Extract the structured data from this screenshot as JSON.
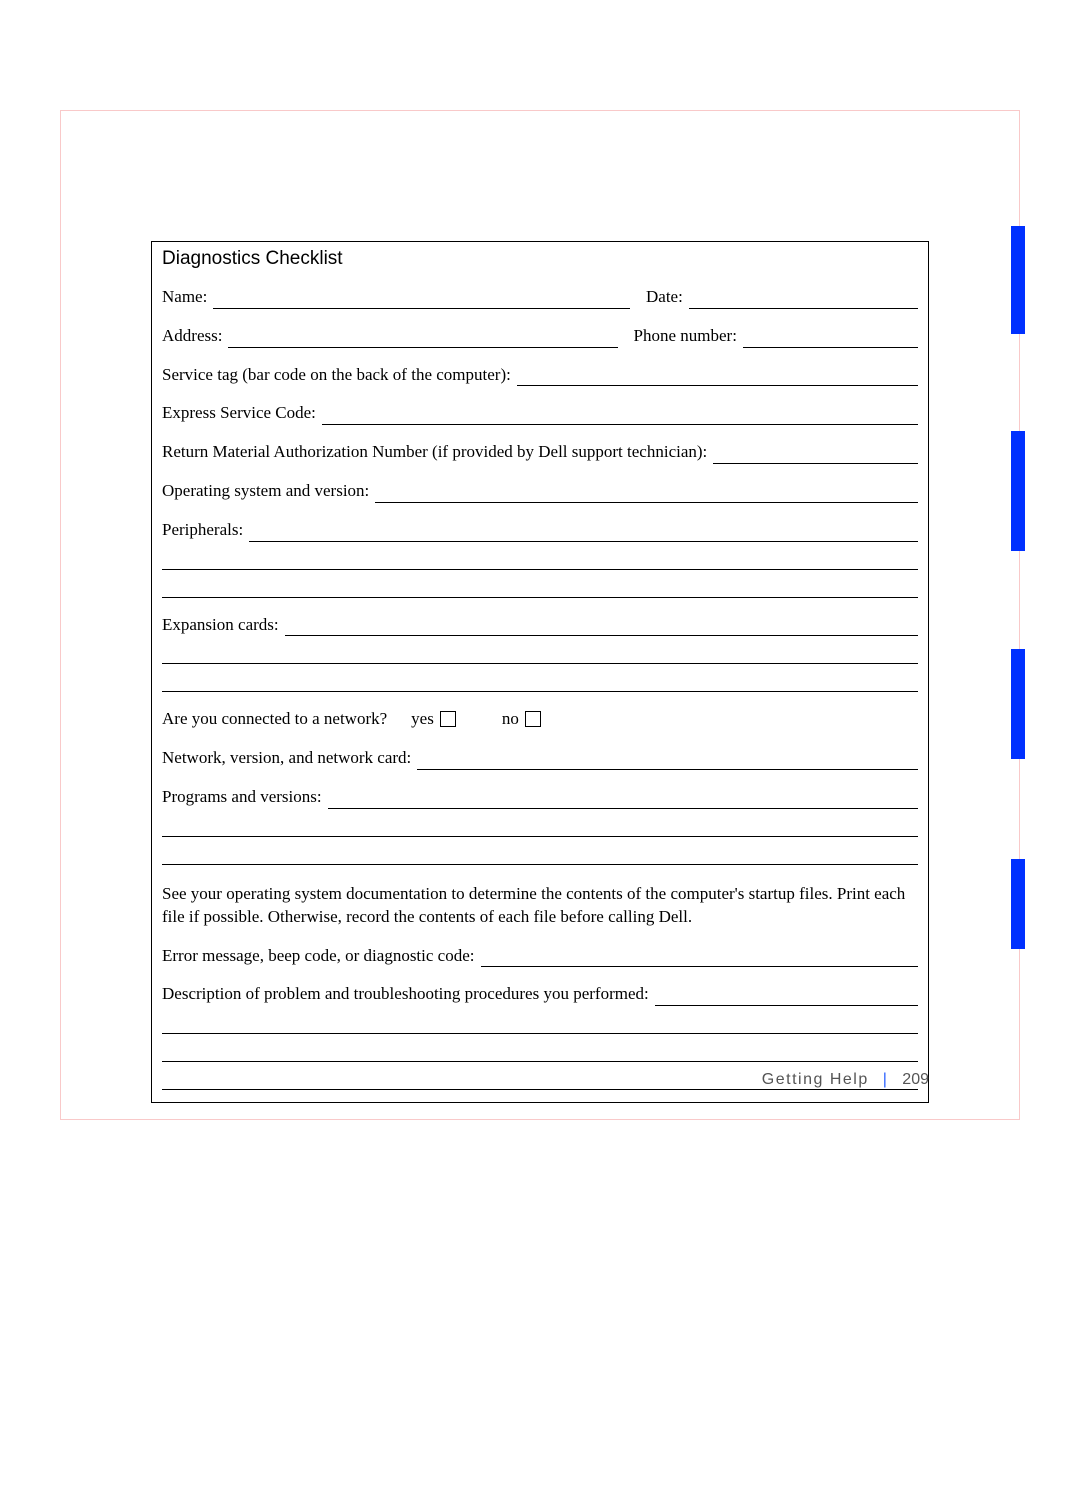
{
  "form": {
    "title": "Diagnostics Checklist",
    "name_label": "Name:",
    "date_label": "Date:",
    "address_label": "Address:",
    "phone_label": "Phone number:",
    "service_tag_label": "Service tag (bar code on the back of the computer):",
    "express_label": "Express Service Code:",
    "rma_label": "Return Material Authorization Number (if provided by Dell support technician):",
    "os_label": "Operating system and version:",
    "peripherals_label": "Peripherals:",
    "expansion_label": "Expansion cards:",
    "network_q": "Are you connected to a network?",
    "yes_label": "yes",
    "no_label": "no",
    "netcard_label": "Network, version, and network card:",
    "programs_label": "Programs and versions:",
    "startup_note": "See your operating system documentation to determine the contents of the computer's startup files. Print each file if possible. Otherwise, record the contents of each file before calling Dell.",
    "error_label": "Error message, beep code, or diagnostic code:",
    "description_label": "Description of problem and troubleshooting procedures you performed:"
  },
  "footer": {
    "section": "Getting Help",
    "separator": "|",
    "page": "209"
  }
}
